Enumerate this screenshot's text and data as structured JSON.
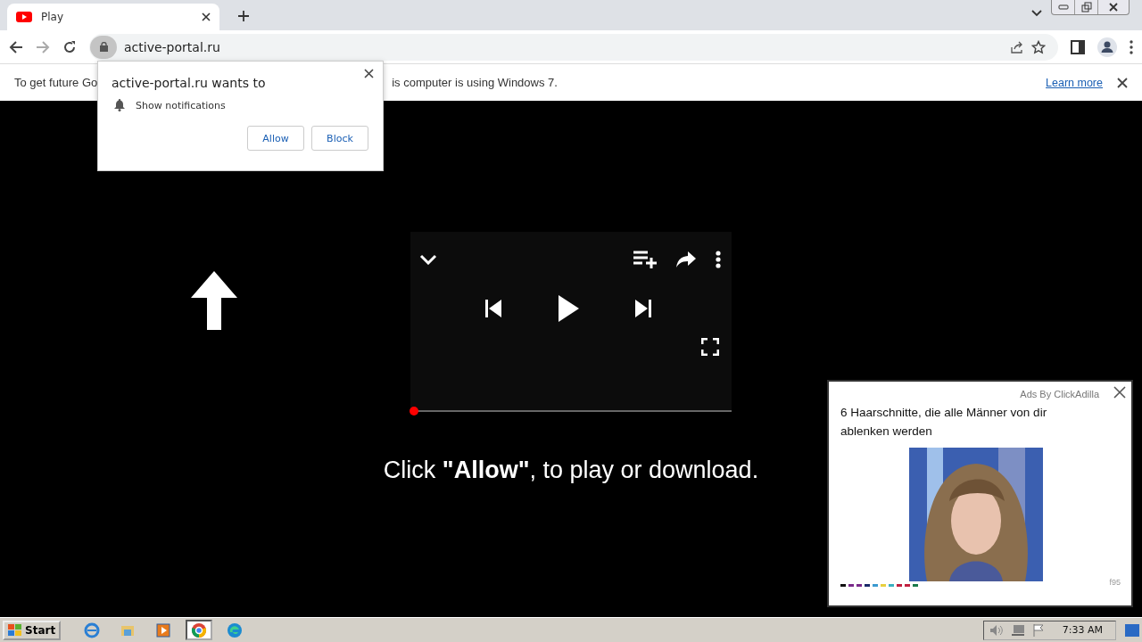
{
  "tab": {
    "title": "Play",
    "selected": true
  },
  "address_bar": {
    "url": "active-portal.ru"
  },
  "info_bar": {
    "text_start": "To get future Go",
    "text_end": "is computer is using Windows 7.",
    "link": "Learn more"
  },
  "permission_popup": {
    "title": "active-portal.ru wants to",
    "permission": "Show notifications",
    "buttons": [
      "Allow",
      "Block"
    ]
  },
  "player": {
    "progress": {
      "level": 0.01
    }
  },
  "caption": "Click **\"Allow\"**, to play or download.",
  "ad": {
    "source": "Ads By ClickAdilla",
    "headline": "6 Haarschnitte, die alle Männer von dir ablenken werden",
    "counter": "f95"
  },
  "taskbar": {
    "start": "Start",
    "apps": [
      {
        "kind": "ie",
        "selected": false
      },
      {
        "kind": "explorer",
        "selected": false
      },
      {
        "kind": "media",
        "selected": false
      },
      {
        "kind": "chrome",
        "selected": true
      },
      {
        "kind": "edge",
        "selected": false
      }
    ],
    "clock": "7:33 AM"
  }
}
